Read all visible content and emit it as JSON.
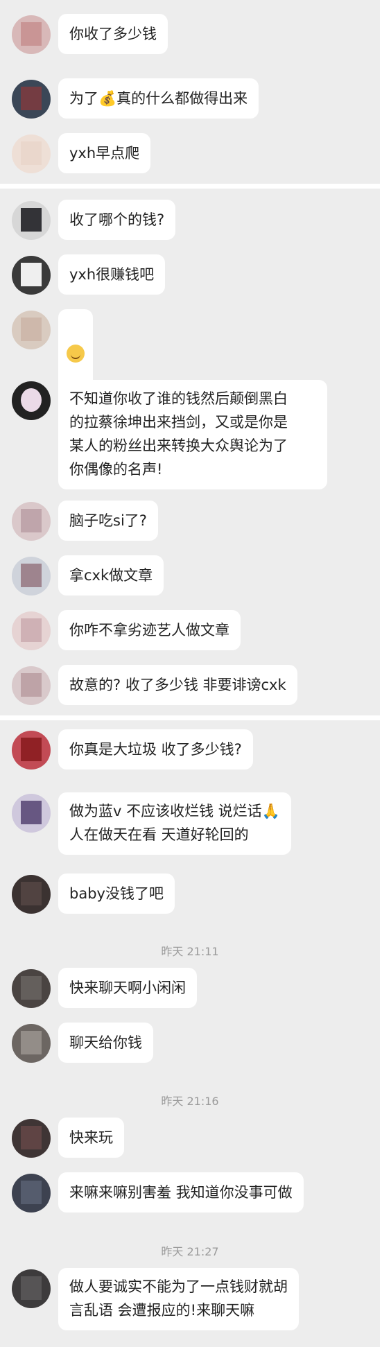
{
  "colors": {
    "chat_background": "#ededed",
    "bubble": "#ffffff",
    "separator": "#ffffff",
    "timestamp": "#9a9a9a"
  },
  "panels": [
    {
      "messages": [
        {
          "text": "你收了多少钱",
          "avatar_color": "#d8b8b8"
        },
        {
          "text": "为了💰真的什么都做得出来",
          "avatar_color": "#7b3b40"
        },
        {
          "text": "yxh早点爬",
          "avatar_color": "#e8d4c8"
        }
      ]
    },
    {
      "messages": [
        {
          "text": "收了哪个的钱?",
          "avatar_color": "#2a2a2e"
        },
        {
          "text": "yxh很赚钱吧",
          "avatar_color": "#efefef"
        },
        {
          "text": "😊",
          "avatar_color": "#c9b2a4"
        },
        {
          "text": "不知道你收了谁的钱然后颠倒黑白\n的拉蔡徐坤出来挡剑，又或是你是\n某人的粉丝出来转换大众舆论为了\n你偶像的名声!",
          "avatar_color": "#f7e5f2"
        },
        {
          "text": "脑子吃si了?",
          "avatar_color": "#b59aa0"
        },
        {
          "text": "拿cxk做文章",
          "avatar_color": "#8e6a74"
        },
        {
          "text": "你咋不拿劣迹艺人做文章",
          "avatar_color": "#c7a6ab"
        },
        {
          "text": "故意的? 收了多少钱 非要诽谤cxk",
          "avatar_color": "#b4959b"
        }
      ]
    },
    {
      "messages": [
        {
          "text": "你真是大垃圾 收了多少钱?",
          "avatar_color": "#8d1f23"
        },
        {
          "text": "做为蓝v 不应该收烂钱 说烂话🙏\n人在做天在看 天道好轮回的",
          "avatar_color": "#5b4a78"
        },
        {
          "text": "baby没钱了吧",
          "avatar_color": "#5a4947"
        }
      ],
      "groups": [
        {
          "time": "昨天 21:11",
          "messages": [
            {
              "text": "快来聊天啊小闲闲",
              "avatar_color": "#6e6866"
            },
            {
              "text": "聊天给你钱",
              "avatar_color": "#a09b96"
            }
          ]
        },
        {
          "time": "昨天 21:16",
          "messages": [
            {
              "text": "快来玩",
              "avatar_color": "#6b4a4a"
            },
            {
              "text": "来嘛来嘛别害羞 我知道你没事可做",
              "avatar_color": "#5d6677"
            }
          ]
        },
        {
          "time": "昨天 21:27",
          "messages": [
            {
              "text": "做人要诚实不能为了一点钱财就胡\n言乱语 会遭报应的!来聊天嘛",
              "avatar_color": "#5f5d5e"
            }
          ]
        }
      ]
    }
  ]
}
